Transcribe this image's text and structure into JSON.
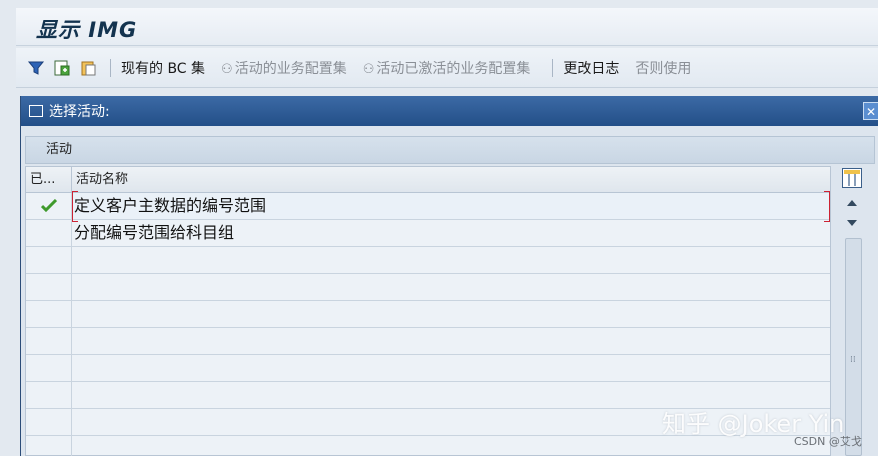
{
  "window": {
    "title": "显示 IMG"
  },
  "toolbar": {
    "existing_bc": "现有的 BC 集",
    "active_bc": "活动的业务配置集",
    "activated_bc": "活动已激活的业务配置集",
    "change_log": "更改日志",
    "otherwise_use": "否则使用",
    "glasses_glyph": "⚇"
  },
  "dialog": {
    "title": "选择活动:",
    "close": "✕",
    "group_label": "活动",
    "table": {
      "headers": [
        "已...",
        "活动名称"
      ],
      "rows": [
        {
          "status": "done",
          "name": "定义客户主数据的编号范围"
        },
        {
          "status": "",
          "name": "分配编号范围给科目组"
        }
      ]
    }
  },
  "colors": {
    "header_blue": "#2c5a96",
    "check_green": "#3f9a2c",
    "disabled_text": "#8a8f96"
  },
  "watermark": {
    "main": "知乎 @Joker Yin",
    "small": "CSDN @艾戈"
  }
}
